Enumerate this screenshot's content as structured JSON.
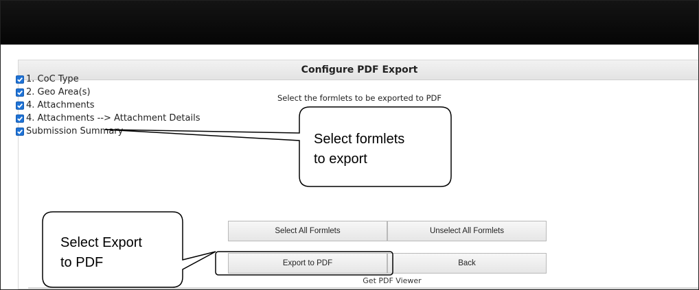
{
  "dialog": {
    "title": "Configure PDF Export",
    "instruction": "Select the formlets to be exported to PDF"
  },
  "formlets": [
    {
      "label": "1. CoC Type",
      "checked": true
    },
    {
      "label": "2. Geo Area(s)",
      "checked": true
    },
    {
      "label": "4. Attachments",
      "checked": true
    },
    {
      "label": "4. Attachments --> Attachment Details",
      "checked": true
    },
    {
      "label": "Submission Summary",
      "checked": true
    }
  ],
  "buttons": {
    "select_all": "Select All Formlets",
    "unselect_all": "Unselect All Formlets",
    "export_pdf": "Export to PDF",
    "back": "Back"
  },
  "links": {
    "get_pdf_viewer": "Get PDF Viewer"
  },
  "callouts": {
    "select_formlets": {
      "line1": "Select formlets",
      "line2": "to export"
    },
    "select_export": {
      "line1": "Select Export",
      "line2": "to PDF"
    }
  },
  "colors": {
    "checkbox_blue": "#1f73d6",
    "topbar": "#0a0a0a",
    "header_bg": "#ebebeb",
    "button_bg": "#eeeeee"
  }
}
